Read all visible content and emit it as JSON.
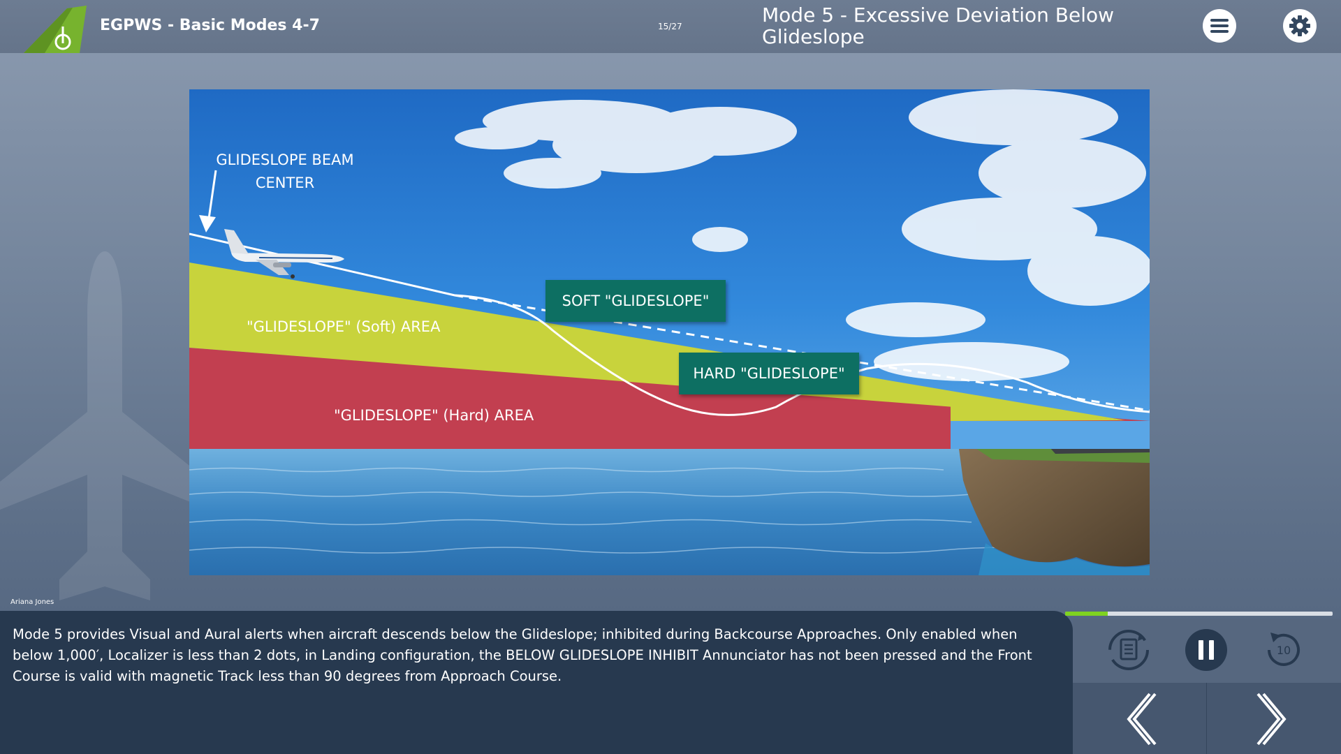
{
  "header": {
    "course_title": "EGPWS - Basic Modes 4-7",
    "page_counter": "15/27",
    "slide_title": "Mode 5 - Excessive Deviation Below Glideslope",
    "logo_icon": "aircraft-tail-logo-icon",
    "menu_icon": "hamburger-menu-icon",
    "settings_icon": "gear-icon"
  },
  "scene": {
    "beam_label": "GLIDESLOPE BEAM CENTER",
    "soft_area_label": "\"GLIDESLOPE\" (Soft) AREA",
    "hard_area_label": "\"GLIDESLOPE\" (Hard) AREA",
    "soft_alert": "SOFT \"GLIDESLOPE\"",
    "hard_alert": "HARD \"GLIDESLOPE\"",
    "colors": {
      "soft_area": "#c8d33c",
      "hard_area": "#c23f50",
      "alert_box": "#0d6f62",
      "sky": "#2a78cf",
      "water": "#3f8fc9"
    }
  },
  "narrator": "Ariana Jones",
  "transcript": "Mode 5 provides Visual and Aural alerts when aircraft descends below the Glideslope; inhibited during Backcourse Approaches. Only enabled when below 1,000′, Localizer is less than 2 dots, in Landing configuration, the BELOW GLIDESLOPE INHIBIT Annunciator has not been pressed and the Front Course is valid with magnetic Track less than 90 degrees from Approach Course.",
  "progress": {
    "fraction": 0.16,
    "color": "#7fd320"
  },
  "controls": {
    "transcript_icon": "transcript-document-icon",
    "pause_icon": "pause-icon",
    "replay_icon": "replay-10-icon",
    "replay_seconds": "10",
    "prev_icon": "chevron-left-icon",
    "next_icon": "chevron-right-icon"
  }
}
